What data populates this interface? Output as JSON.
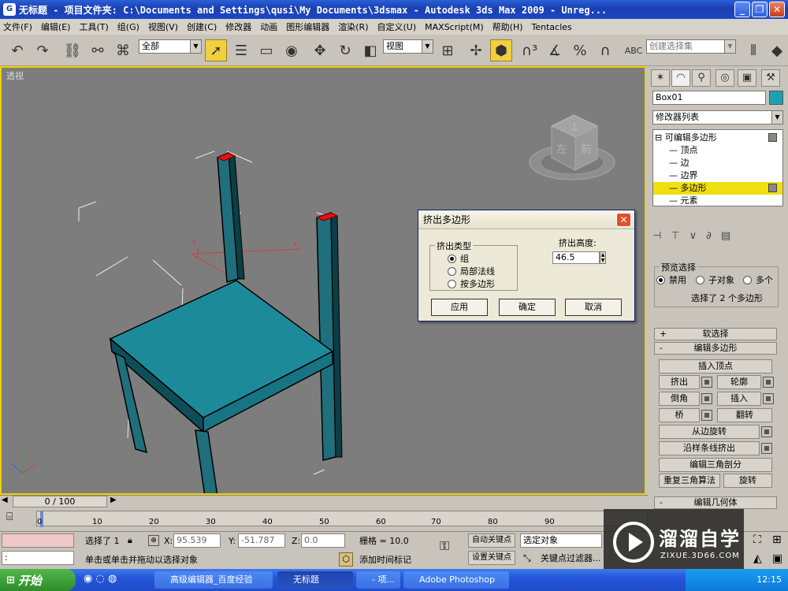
{
  "window": {
    "title": "无标题    - 项目文件夹: C:\\Documents and Settings\\qusi\\My Documents\\3dsmax    - Autodesk 3ds Max  2009  - Unreg...",
    "min": "_",
    "max": "❐",
    "close": "✕"
  },
  "menu": [
    "文件(F)",
    "编辑(E)",
    "工具(T)",
    "组(G)",
    "视图(V)",
    "创建(C)",
    "修改器",
    "动画",
    "图形编辑器",
    "渲染(R)",
    "自定义(U)",
    "MAXScript(M)",
    "帮助(H)",
    "Tentacles"
  ],
  "toolbar": {
    "selection_filter": "全部",
    "ref_coord": "视图",
    "named_sel": "创建选择集"
  },
  "viewport": {
    "label": "透视",
    "viewcube_front": "前",
    "viewcube_left": "左",
    "viewcube_top": "上",
    "axis_x": "x",
    "axis_y": "y"
  },
  "dialog": {
    "title": "挤出多边形",
    "group_label": "挤出类型",
    "options": [
      "组",
      "局部法线",
      "按多边形"
    ],
    "selected": 0,
    "height_label": "挤出高度:",
    "height_value": "46.5",
    "apply": "应用",
    "ok": "确定",
    "cancel": "取消"
  },
  "panel": {
    "object_name": "Box01",
    "modifier_list": "修改器列表",
    "stack": [
      "可编辑多边形",
      "顶点",
      "边",
      "边界",
      "多边形",
      "元素"
    ],
    "stack_selected": 4,
    "preview_label": "预览选择",
    "preview_opts": [
      "禁用",
      "子对象",
      "多个"
    ],
    "selection_info": "选择了 2 个多边形",
    "rollout_soft": "软选择",
    "rollout_soft_sign": "+",
    "rollout_edit": "编辑多边形",
    "rollout_edit_sign": "-",
    "rollout_geo": "编辑几何体",
    "rollout_geo_sign": "-",
    "insert_vertex": "插入顶点",
    "btn_extrude": "挤出",
    "btn_outline": "轮廓",
    "btn_bevel": "倒角",
    "btn_inset": "插入",
    "btn_bridge": "桥",
    "btn_flip": "翻转",
    "btn_hinge": "从边旋转",
    "btn_spline": "沿样条线挤出",
    "btn_tri": "编辑三角剖分",
    "btn_retri": "重复三角算法",
    "btn_turn": "旋转"
  },
  "timeline": {
    "frame": "0 / 100",
    "ticks": [
      "0",
      "10",
      "20",
      "30",
      "40",
      "50",
      "60",
      "70",
      "80",
      "90"
    ]
  },
  "status": {
    "selected": "选择了 1",
    "x_label": "X:",
    "x": "95.539",
    "y_label": "Y:",
    "y": "-51.787",
    "z_label": "Z:",
    "z": "0.0",
    "grid": "栅格 = 10.0",
    "auto_key": "自动关键点",
    "set_key": "设置关键点",
    "sel_obj": "选定对象",
    "key_filter": "关键点过滤器...",
    "prompt": "单击或单击并拖动以选择对象",
    "add_time_tag": "添加时间标记",
    "maxscript": ":"
  },
  "taskbar": {
    "start": "开始",
    "tasks": [
      "高级编辑器_百度经验",
      "无标题",
      "- 项...",
      "Adobe Photoshop"
    ],
    "active": 1,
    "clock": "12:15"
  },
  "watermark": {
    "brand": "溜溜自学",
    "url": "ZIXUE.3D66.COM"
  }
}
